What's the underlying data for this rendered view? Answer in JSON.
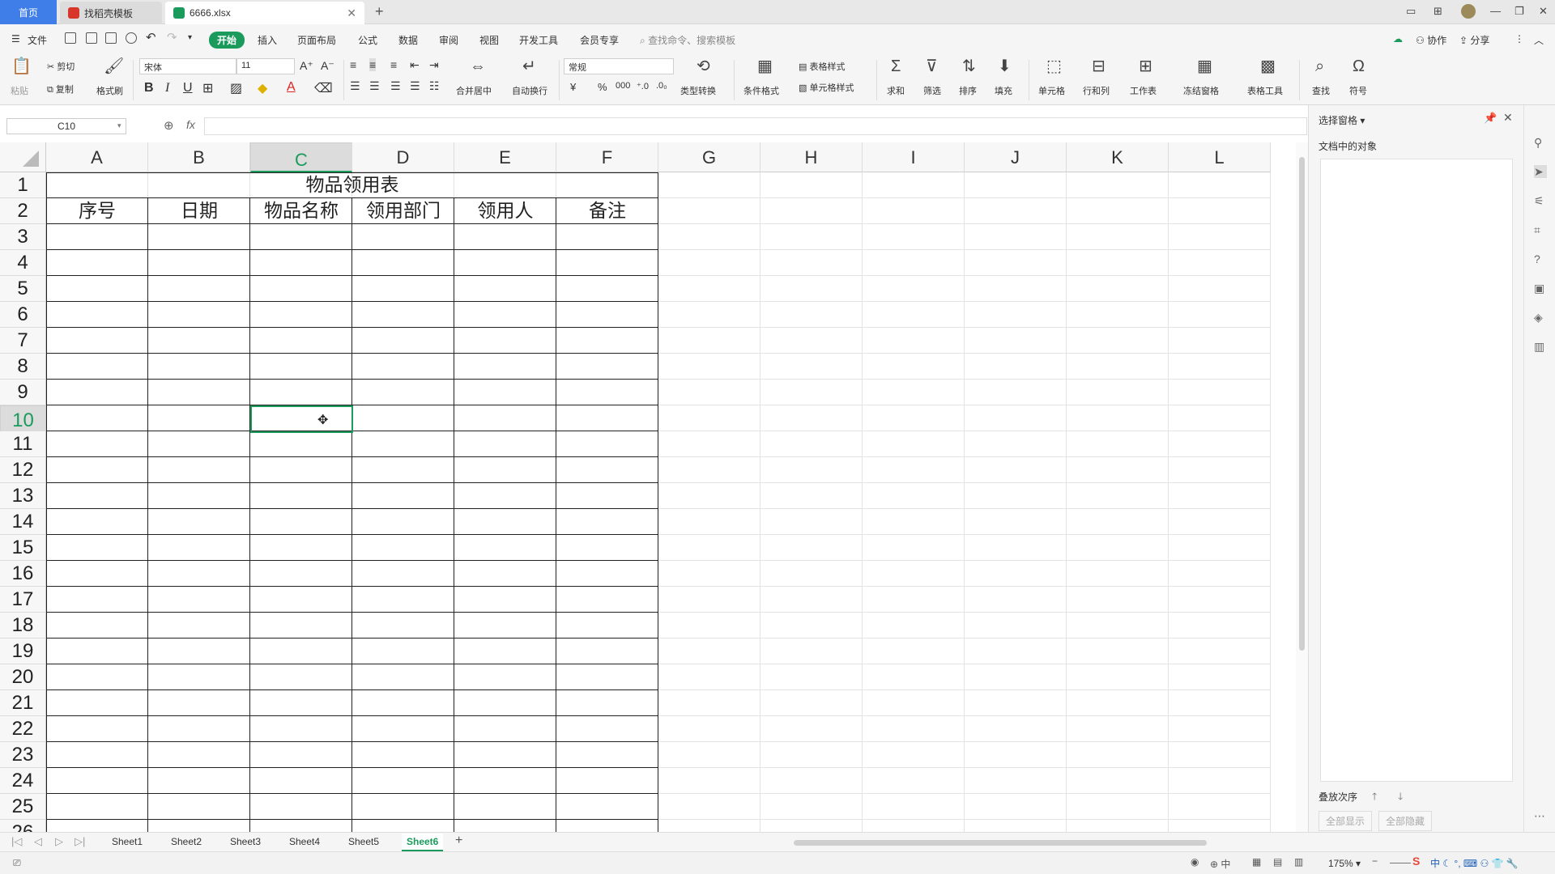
{
  "tabs": {
    "home": "首页",
    "template": "找稻壳模板",
    "file": "6666.xlsx"
  },
  "menu": {
    "file": "文件",
    "items": [
      "开始",
      "插入",
      "页面布局",
      "公式",
      "数据",
      "审阅",
      "视图",
      "开发工具",
      "会员专享"
    ],
    "search": "查找命令、搜索模板",
    "collab": "协作",
    "share": "分享"
  },
  "ribbon": {
    "paste": "粘贴",
    "cut": "剪切",
    "copy": "复制",
    "format_painter": "格式刷",
    "font_name": "宋体",
    "font_size": "11",
    "merge": "合并居中",
    "wrap": "自动换行",
    "number_format": "常规",
    "type_convert": "类型转换",
    "cond_format": "条件格式",
    "table_style": "表格样式",
    "cell_style": "单元格样式",
    "sum": "求和",
    "filter": "筛选",
    "sort": "排序",
    "fill": "填充",
    "cell": "单元格",
    "row_col": "行和列",
    "worksheet": "工作表",
    "freeze": "冻结窗格",
    "table_tools": "表格工具",
    "find": "查找",
    "symbol": "符号",
    "bold": "B",
    "italic": "I",
    "underline": "U",
    "font_color": "A",
    "currency": "¥",
    "percent": "%",
    "thousand": "000"
  },
  "formula_bar": {
    "name_box": "C10",
    "fx": "fx",
    "formula": ""
  },
  "grid": {
    "columns": [
      "A",
      "B",
      "C",
      "D",
      "E",
      "F",
      "G",
      "H",
      "I",
      "J",
      "K",
      "L"
    ],
    "rows": [
      "1",
      "2",
      "3",
      "4",
      "5",
      "6",
      "7",
      "8",
      "9",
      "10",
      "11",
      "12",
      "13",
      "14",
      "15",
      "16",
      "17",
      "18",
      "19",
      "20",
      "21",
      "22",
      "23",
      "24",
      "25",
      "26"
    ],
    "title": "物品领用表",
    "headers": [
      "序号",
      "日期",
      "物品名称",
      "领用部门",
      "领用人",
      "备注"
    ],
    "selected_cell": "C10"
  },
  "panel": {
    "title": "选择窗格",
    "objects_label": "文档中的对象",
    "order_label": "叠放次序",
    "show_all": "全部显示",
    "hide_all": "全部隐藏"
  },
  "sheets": [
    "Sheet1",
    "Sheet2",
    "Sheet3",
    "Sheet4",
    "Sheet5",
    "Sheet6"
  ],
  "active_sheet": "Sheet6",
  "status": {
    "zoom": "175%",
    "ime": "中"
  },
  "colors": {
    "accent": "#1a9b5c",
    "home_tab": "#3f7ee8"
  }
}
